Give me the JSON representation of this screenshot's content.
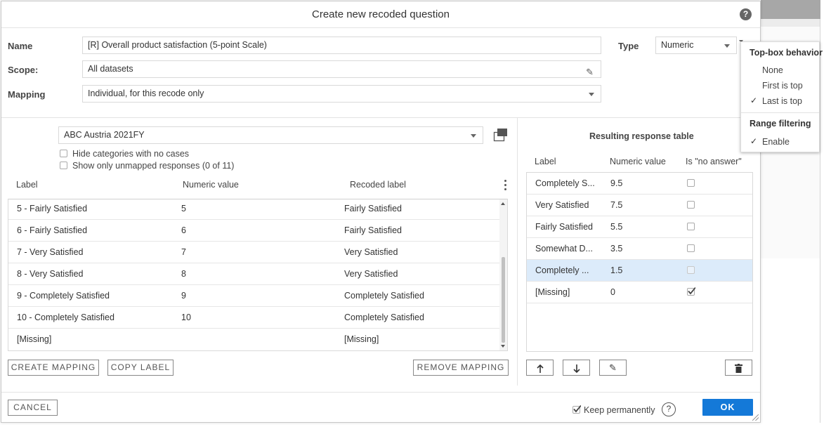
{
  "dialog": {
    "title": "Create new recoded question",
    "help_glyph": "?"
  },
  "form": {
    "name_label": "Name",
    "name_value": "[R] Overall product satisfaction (5-point Scale)",
    "scope_label": "Scope:",
    "scope_value": "All datasets",
    "mapping_label": "Mapping",
    "mapping_value": "Individual, for this recode only",
    "type_label": "Type",
    "type_value": "Numeric"
  },
  "left_panel": {
    "dataset_value": "ABC Austria 2021FY",
    "hide_empty_label": "Hide categories with no cases",
    "show_unmapped_label": "Show only unmapped responses (0 of 11)",
    "columns": [
      "Label",
      "Numeric value",
      "Recoded label"
    ],
    "rows": [
      {
        "label": "5 - Fairly Satisfied",
        "value": "5",
        "recoded": "Fairly Satisfied"
      },
      {
        "label": "6 - Fairly Satisfied",
        "value": "6",
        "recoded": "Fairly Satisfied"
      },
      {
        "label": "7 - Very Satisfied",
        "value": "7",
        "recoded": "Very Satisfied"
      },
      {
        "label": "8 - Very Satisfied",
        "value": "8",
        "recoded": "Very Satisfied"
      },
      {
        "label": "9 - Completely Satisfied",
        "value": "9",
        "recoded": "Completely Satisfied"
      },
      {
        "label": "10 - Completely Satisfied",
        "value": "10",
        "recoded": "Completely Satisfied"
      },
      {
        "label": "[Missing]",
        "value": "",
        "recoded": "[Missing]"
      }
    ],
    "create_mapping_label": "CREATE MAPPING",
    "copy_label_label": "COPY LABEL",
    "remove_mapping_label": "REMOVE MAPPING"
  },
  "right_panel": {
    "title": "Resulting response table",
    "columns": [
      "Label",
      "Numeric value",
      "Is \"no answer\""
    ],
    "rows": [
      {
        "label": "Completely S...",
        "value": "9.5",
        "no_answer": false
      },
      {
        "label": "Very Satisfied",
        "value": "7.5",
        "no_answer": false
      },
      {
        "label": "Fairly Satisfied",
        "value": "5.5",
        "no_answer": false
      },
      {
        "label": "Somewhat D...",
        "value": "3.5",
        "no_answer": false
      },
      {
        "label": "Completely ...",
        "value": "1.5",
        "no_answer": false
      },
      {
        "label": "[Missing]",
        "value": "0",
        "no_answer": true
      }
    ],
    "selected_row": 4
  },
  "footer": {
    "cancel_label": "CANCEL",
    "keep_label": "Keep permanently",
    "keep_checked": true,
    "ok_label": "OK"
  },
  "menu": {
    "topbox_heading": "Top-box behavior",
    "topbox_options": [
      "None",
      "First is top",
      "Last is top"
    ],
    "topbox_selected": "Last is top",
    "range_heading": "Range filtering",
    "range_options": [
      "Enable"
    ],
    "range_checked": true,
    "check_glyph": "✓"
  },
  "colors": {
    "ok_button": "#1479d8",
    "selected_row": "#dcebfa"
  }
}
